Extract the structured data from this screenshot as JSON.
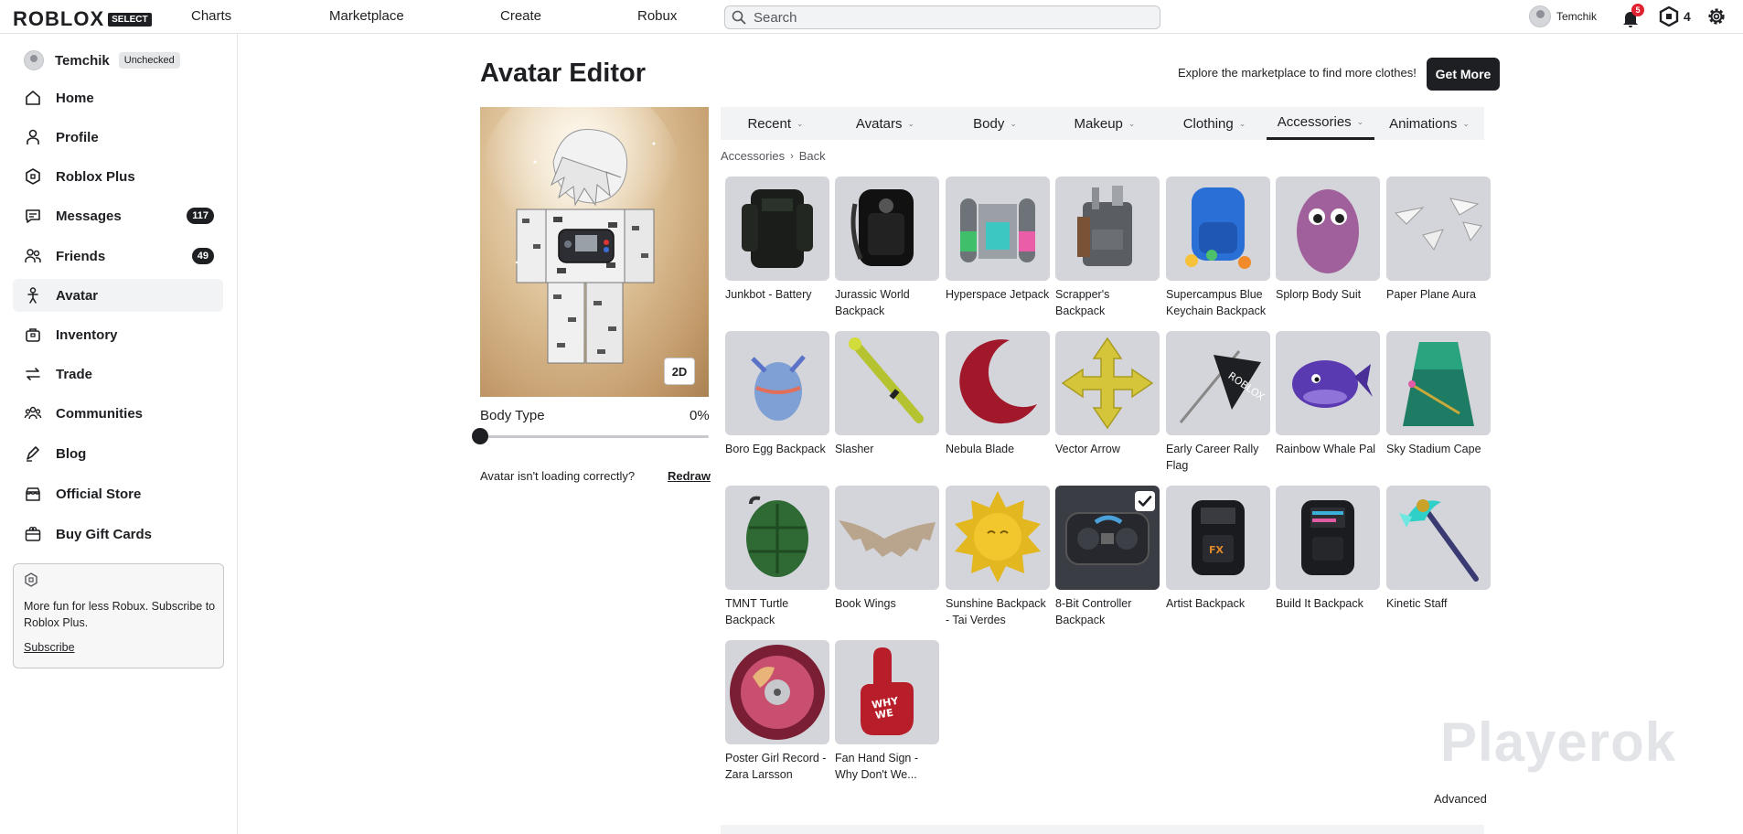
{
  "topbar": {
    "logo_word": "ROBLOX",
    "logo_badge": "SELECT",
    "nav": [
      "Charts",
      "Marketplace",
      "Create",
      "Robux"
    ],
    "search_placeholder": "Search",
    "username": "Temchik",
    "notification_count": "5",
    "robux_count": "4"
  },
  "sidebar": {
    "username": "Temchik",
    "user_chip": "Unchecked",
    "items": [
      {
        "label": "Home",
        "icon": "home-icon"
      },
      {
        "label": "Profile",
        "icon": "profile-icon"
      },
      {
        "label": "Roblox Plus",
        "icon": "roblox-plus-icon"
      },
      {
        "label": "Messages",
        "icon": "messages-icon",
        "count": "117"
      },
      {
        "label": "Friends",
        "icon": "friends-icon",
        "count": "49"
      },
      {
        "label": "Avatar",
        "icon": "avatar-icon",
        "active": true
      },
      {
        "label": "Inventory",
        "icon": "inventory-icon"
      },
      {
        "label": "Trade",
        "icon": "trade-icon"
      },
      {
        "label": "Communities",
        "icon": "communities-icon"
      },
      {
        "label": "Blog",
        "icon": "blog-icon"
      },
      {
        "label": "Official Store",
        "icon": "store-icon"
      },
      {
        "label": "Buy Gift Cards",
        "icon": "gift-card-icon"
      }
    ],
    "promo": {
      "text": "More fun for less Robux. Subscribe to Roblox Plus.",
      "link": "Subscribe"
    }
  },
  "main": {
    "title": "Avatar Editor",
    "explore_text": "Explore the marketplace to find more clothes!",
    "get_more_label": "Get More",
    "preview_toggle": "2D",
    "body_type": {
      "label": "Body Type",
      "value_text": "0%",
      "value": 0
    },
    "loading_text": "Avatar isn't loading correctly?",
    "redraw_label": "Redraw",
    "tabs": [
      {
        "label": "Recent"
      },
      {
        "label": "Avatars"
      },
      {
        "label": "Body"
      },
      {
        "label": "Makeup"
      },
      {
        "label": "Clothing"
      },
      {
        "label": "Accessories",
        "active": true
      },
      {
        "label": "Animations"
      }
    ],
    "breadcrumb": [
      "Accessories",
      "Back"
    ],
    "items": [
      {
        "name": "Junkbot - Battery"
      },
      {
        "name": "Jurassic World Backpack"
      },
      {
        "name": "Hyperspace Jetpack"
      },
      {
        "name": "Scrapper's Backpack"
      },
      {
        "name": "Supercampus Blue Keychain Backpack"
      },
      {
        "name": "Splorp Body Suit"
      },
      {
        "name": "Paper Plane Aura"
      },
      {
        "name": "Boro Egg Backpack"
      },
      {
        "name": "Slasher"
      },
      {
        "name": "Nebula Blade"
      },
      {
        "name": "Vector Arrow"
      },
      {
        "name": "Early Career Rally Flag"
      },
      {
        "name": "Rainbow Whale Pal"
      },
      {
        "name": "Sky Stadium Cape"
      },
      {
        "name": "TMNT Turtle Backpack"
      },
      {
        "name": "Book Wings"
      },
      {
        "name": "Sunshine Backpack - Tai Verdes"
      },
      {
        "name": "8-Bit Controller Backpack",
        "selected": true
      },
      {
        "name": "Artist Backpack"
      },
      {
        "name": "Build It Backpack"
      },
      {
        "name": "Kinetic Staff"
      },
      {
        "name": "Poster Girl Record - Zara Larsson"
      },
      {
        "name": "Fan Hand Sign - Why Don't We..."
      }
    ],
    "advanced_label": "Advanced",
    "watermark": "Playerok"
  },
  "colors": {
    "text": "#1e1f22",
    "accent_dark": "#1e1f22",
    "badge_red": "#e0212f",
    "tile_bg": "#d4d5da",
    "tab_bg": "#f2f3f4"
  }
}
